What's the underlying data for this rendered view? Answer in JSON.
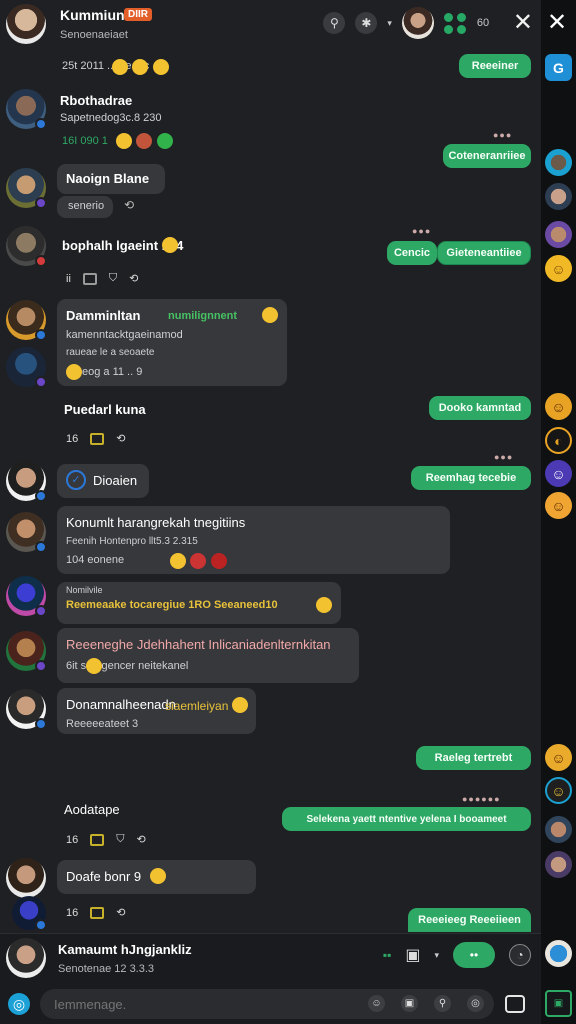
{
  "header": {
    "title": "Kummiun",
    "badge": "DIIR",
    "subtitle": "Senoenaeiaet",
    "count": "60",
    "close": "✕"
  },
  "rail": {
    "close": "✕"
  },
  "messages": [
    {
      "side": "in",
      "name": "",
      "sub": "25t  2011  ... 1eaec"
    },
    {
      "side": "out",
      "text": "Reeeiner"
    },
    {
      "side": "in",
      "name": "Rbothadrae",
      "sub": "Sapetnedog3c.8 230",
      "sub2": "16I  090     1"
    },
    {
      "side": "out",
      "text": "Coteneranriiee"
    },
    {
      "side": "in",
      "name": "Naoign Blane",
      "sub": "senerio"
    },
    {
      "side": "in",
      "name": "bophalh lgaeint ... 4",
      "sub": "ii"
    },
    {
      "side": "out",
      "text": "Cencic",
      "text2": "Gieteneantiiee"
    },
    {
      "side": "in",
      "name": "Damminltan",
      "name2": "numilignnent",
      "sub": "kamenntacktgaeinamod",
      "sub2": "raueae le a seoaete",
      "sub3": "eog a 11   ..   9"
    },
    {
      "side": "in",
      "name": "Puedarl kuna",
      "sub": "16"
    },
    {
      "side": "out",
      "text": "Dooko kamntad"
    },
    {
      "side": "in",
      "name": "Dioaien"
    },
    {
      "side": "out",
      "text": "Reemhag tecebie"
    },
    {
      "side": "in",
      "name": "Konumlt harangrekah tnegitiins",
      "sub": "Feenih      Hontenpro llt5.3 2.315",
      "sub2": "104      eonene"
    },
    {
      "side": "in",
      "name": "Nomilvile",
      "sub": "Reemeaake tocaregiue 1RO  Seeaneed10",
      "sub2": ""
    },
    {
      "side": "in",
      "name": "Reeeneghe Jdehhahent Inlicaniadenlternkitan",
      "sub": "6it    samgencer neitekanel"
    },
    {
      "side": "in",
      "name": "Donamnalheenadn",
      "name2": "siaemleiyan",
      "sub": "Reeeeeateet   3"
    },
    {
      "side": "out",
      "text": "Raeleg tertrebt"
    },
    {
      "side": "in",
      "name": "Aodatape",
      "sub": "16"
    },
    {
      "side": "out",
      "text": "Selekena yaett ntentive yelena I booameet"
    },
    {
      "side": "in",
      "name": "Doafe bonr 9",
      "sub": "16"
    },
    {
      "side": "out",
      "text": "Reeeieeg Reeeiieen"
    }
  ],
  "composer": {
    "name": "Kamaumt hJngjankliz",
    "sub": "Senotenae 12 3.3.3",
    "placeholder": "Iemmenage.",
    "send_label": "••"
  },
  "colors": {
    "accent": "#2ea865",
    "bubble_in": "#37383c",
    "background": "#1f2023",
    "rail": "#0f1012"
  }
}
